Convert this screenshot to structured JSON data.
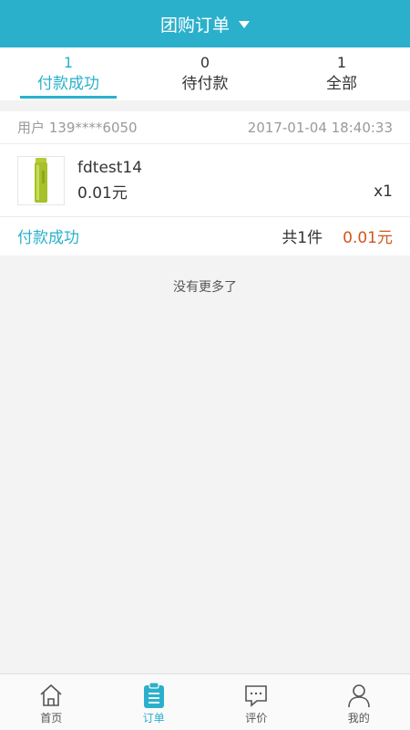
{
  "header": {
    "title": "团购订单",
    "dropdown_icon": "caret-down-icon"
  },
  "tabs": [
    {
      "count": "1",
      "label": "付款成功",
      "active": true
    },
    {
      "count": "0",
      "label": "待付款",
      "active": false
    },
    {
      "count": "1",
      "label": "全部",
      "active": false
    }
  ],
  "order": {
    "user": "用户 139****6050",
    "time": "2017-01-04 18:40:33",
    "item": {
      "name": "fdtest14",
      "price": "0.01元",
      "qty": "x1",
      "image_icon": "product-bottle-icon"
    },
    "status": "付款成功",
    "total_count": "共1件",
    "total_price": "0.01元"
  },
  "no_more": "没有更多了",
  "bottom_nav": [
    {
      "label": "首页",
      "icon": "home-icon",
      "active": false
    },
    {
      "label": "订单",
      "icon": "order-list-icon",
      "active": true
    },
    {
      "label": "评价",
      "icon": "comment-icon",
      "active": false
    },
    {
      "label": "我的",
      "icon": "user-icon",
      "active": false
    }
  ],
  "colors": {
    "accent": "#2bb0cc",
    "price": "#d2551e",
    "background": "#f3f3f3"
  }
}
